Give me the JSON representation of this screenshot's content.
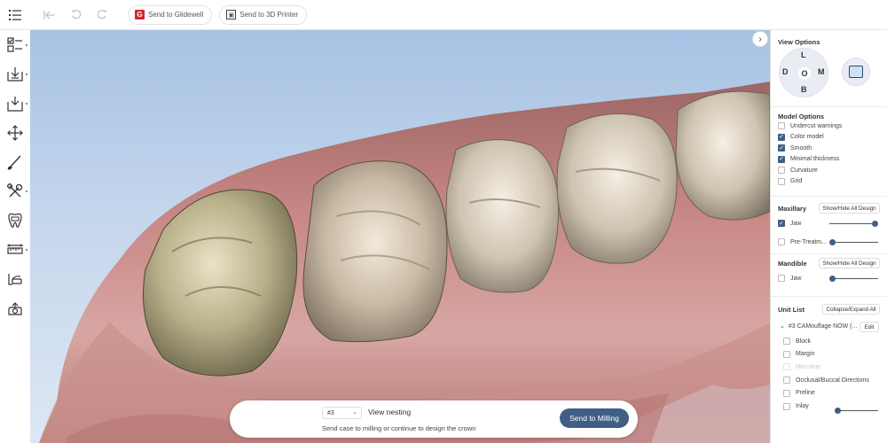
{
  "toolbar": {
    "send_glidewell": "Send to Glidewell",
    "glidewell_badge": "G",
    "send_3d_printer": "Send to 3D Printer"
  },
  "left_tools": [
    {
      "icon": "design-checklist-icon"
    },
    {
      "icon": "import-scan-icon"
    },
    {
      "icon": "export-icon"
    },
    {
      "icon": "move-icon"
    },
    {
      "icon": "brush-icon"
    },
    {
      "icon": "tools-icon"
    },
    {
      "icon": "tooth-icon"
    },
    {
      "icon": "measure-icon"
    },
    {
      "icon": "articulator-icon"
    },
    {
      "icon": "camera-icon"
    }
  ],
  "view_options": {
    "title": "View Options",
    "directions": {
      "top": "L",
      "left": "D",
      "center": "O",
      "right": "M",
      "bottom": "B"
    }
  },
  "model_options": {
    "title": "Model Options",
    "items": [
      {
        "label": "Undercut warnings",
        "checked": false
      },
      {
        "label": "Color model",
        "checked": true
      },
      {
        "label": "Smooth",
        "checked": true
      },
      {
        "label": "Minimal thickness",
        "checked": true
      },
      {
        "label": "Curvature",
        "checked": false
      },
      {
        "label": "Grid",
        "checked": false
      }
    ]
  },
  "maxillary": {
    "title": "Maxillary",
    "button": "Show/Hide All Design",
    "jaw_label": "Jaw",
    "jaw_checked": true,
    "jaw_opacity": 1.0,
    "pretreatment_label": "Pre-Treatm...",
    "pretreatment_checked": false,
    "pretreatment_opacity": 0.0
  },
  "mandible": {
    "title": "Mandible",
    "button": "Show/Hide All Design",
    "jaw_label": "Jaw",
    "jaw_checked": false,
    "jaw_opacity": 0.0
  },
  "unit_list": {
    "title": "Unit List",
    "button": "Collapse/Expand All",
    "unit_label": "#3 CAMouflage NOW (...",
    "edit": "Edit",
    "items": [
      {
        "label": "Block",
        "checked": false,
        "disabled": false
      },
      {
        "label": "Margin",
        "checked": false,
        "disabled": false
      },
      {
        "label": "Microline",
        "checked": false,
        "disabled": true
      },
      {
        "label": "Occlusal/Buccal Directions",
        "checked": false,
        "disabled": false
      },
      {
        "label": "Preline",
        "checked": false,
        "disabled": false
      },
      {
        "label": "Inlay",
        "checked": false,
        "disabled": false
      }
    ],
    "inlay_opacity": 0.0
  },
  "send_panel": {
    "unit_value": "#3",
    "view_nesting": "View nesting",
    "hint": "Send case to milling or continue to design the crown",
    "send_button": "Send to Milling"
  },
  "colors": {
    "accent": "#3f5f86",
    "glidewell_red": "#d9262c",
    "background_top": "#a6c2e4",
    "gum": "#c57f7e"
  }
}
